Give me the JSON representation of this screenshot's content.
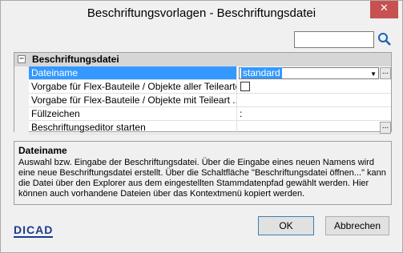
{
  "window": {
    "title": "Beschriftungsvorlagen - Beschriftungsdatei",
    "close_glyph": "✕"
  },
  "search": {
    "value": "",
    "placeholder": ""
  },
  "grid": {
    "category": {
      "expand_glyph": "−",
      "label": "Beschriftungsdatei"
    },
    "rows": [
      {
        "label": "Dateiname",
        "value": "standard"
      },
      {
        "label": "Vorgabe für Flex-Bauteile / Objekte aller Teilearten",
        "value": ""
      },
      {
        "label": "Vorgabe für Flex-Bauteile / Objekte mit Teileart ...",
        "value": ""
      },
      {
        "label": "Füllzeichen",
        "value": ":"
      },
      {
        "label": "Beschriftungseditor starten",
        "value": ""
      }
    ],
    "ellipsis": "..."
  },
  "description": {
    "title": "Dateiname",
    "text": "Auswahl bzw. Eingabe der Beschriftungsdatei. Über die Eingabe eines neuen Namens wird eine neue Beschriftungsdatei erstellt. Über die Schaltfläche \"Beschriftungsdatei öffnen...\" kann die Datei über den Explorer aus dem eingestellten Stammdatenpfad gewählt werden. Hier können auch vorhandene Dateien über das Kontextmenü kopiert werden."
  },
  "logo": {
    "text": "DICAD"
  },
  "buttons": {
    "ok": "OK",
    "cancel": "Abbrechen"
  },
  "colors": {
    "accent": "#3399ff",
    "close": "#c75050",
    "logo": "#1a3a8c"
  }
}
